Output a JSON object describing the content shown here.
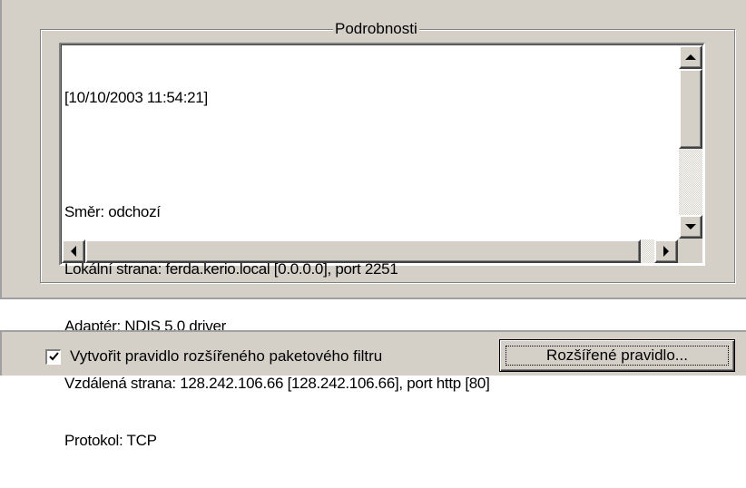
{
  "details": {
    "title": "Podrobnosti",
    "lines": [
      "[10/10/2003 11:54:21]",
      "",
      "Směr: odchozí",
      "Lokální strana: ferda.kerio.local [0.0.0.0], port 2251",
      "Adaptér: NDIS 5.0 driver",
      "Vzdálená strana: 128.242.106.66 [128.242.106.66], port http [80]",
      "Protokol: TCP"
    ]
  },
  "scrollbars": {
    "up_icon": "arrow-up-icon",
    "down_icon": "arrow-down-icon",
    "left_icon": "arrow-left-icon",
    "right_icon": "arrow-right-icon"
  },
  "rule": {
    "checkbox_label": "Vytvořit pravidlo rozšířeného paketového filtru",
    "checked": true,
    "button_label": "Rozšířené pravidlo..."
  },
  "colors": {
    "face": "#d4d0c8",
    "shadow": "#808080",
    "highlight": "#ffffff"
  }
}
